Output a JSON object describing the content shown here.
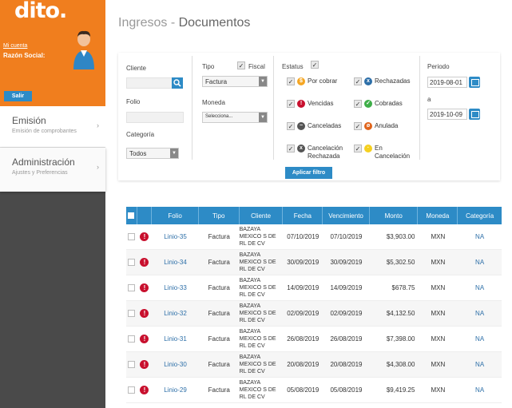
{
  "brand": {
    "logo": "dito.",
    "account_link": "Mi cuenta",
    "social_label": "Razón Social:",
    "logout": "Salir"
  },
  "menu": [
    {
      "title": "Emisión",
      "subtitle": "Emisión de comprobantes"
    },
    {
      "title": "Administración",
      "subtitle": "Ajustes y Preferencias"
    }
  ],
  "page_title": {
    "section": "Ingresos",
    "sep": " - ",
    "page": "Documentos"
  },
  "filters": {
    "cliente_label": "Cliente",
    "folio_label": "Folio",
    "categoria_label": "Categoría",
    "categoria_value": "Todos",
    "tipo_label": "Tipo",
    "fiscal_label": "Fiscal",
    "tipo_value": "Factura",
    "moneda_label": "Moneda",
    "moneda_value": "Selecciona...",
    "estatus_label": "Estatus",
    "statuses": [
      {
        "label": "Por cobrar",
        "color": "#f5a623",
        "glyph": "$"
      },
      {
        "label": "Rechazadas",
        "color": "#2d6fa8",
        "glyph": "x"
      },
      {
        "label": "Vencidas",
        "color": "#c8102e",
        "glyph": "!"
      },
      {
        "label": "Cobradas",
        "color": "#3fae49",
        "glyph": "✓"
      },
      {
        "label": "Canceladas",
        "color": "#555555",
        "glyph": "−"
      },
      {
        "label": "Anulada",
        "color": "#e0641b",
        "glyph": "ø"
      },
      {
        "label": "Cancelación Rechazada",
        "color": "#555555",
        "glyph": "x"
      },
      {
        "label": "En Cancelación",
        "color": "#f5d020",
        "glyph": "·"
      }
    ],
    "periodo_label": "Periodo",
    "date_from": "2019-08-01",
    "a_label": "a",
    "date_to": "2019-10-09",
    "apply": "Aplicar filtro"
  },
  "table": {
    "headers": [
      "Folio",
      "Tipo",
      "Cliente",
      "Fecha",
      "Vencimiento",
      "Monto",
      "Moneda",
      "Categoría"
    ],
    "rows": [
      {
        "folio": "Linio-35",
        "tipo": "Factura",
        "cliente": "BAZAYA MEXICO S DE RL DE CV",
        "fecha": "07/10/2019",
        "venc": "07/10/2019",
        "monto": "$3,903.00",
        "moneda": "MXN",
        "cat": "NA"
      },
      {
        "folio": "Linio-34",
        "tipo": "Factura",
        "cliente": "BAZAYA MEXICO S DE RL DE CV",
        "fecha": "30/09/2019",
        "venc": "30/09/2019",
        "monto": "$5,302.50",
        "moneda": "MXN",
        "cat": "NA"
      },
      {
        "folio": "Linio-33",
        "tipo": "Factura",
        "cliente": "BAZAYA MEXICO S DE RL DE CV",
        "fecha": "14/09/2019",
        "venc": "14/09/2019",
        "monto": "$678.75",
        "moneda": "MXN",
        "cat": "NA"
      },
      {
        "folio": "Linio-32",
        "tipo": "Factura",
        "cliente": "BAZAYA MEXICO S DE RL DE CV",
        "fecha": "02/09/2019",
        "venc": "02/09/2019",
        "monto": "$4,132.50",
        "moneda": "MXN",
        "cat": "NA"
      },
      {
        "folio": "Linio-31",
        "tipo": "Factura",
        "cliente": "BAZAYA MEXICO S DE RL DE CV",
        "fecha": "26/08/2019",
        "venc": "26/08/2019",
        "monto": "$7,398.00",
        "moneda": "MXN",
        "cat": "NA"
      },
      {
        "folio": "Linio-30",
        "tipo": "Factura",
        "cliente": "BAZAYA MEXICO S DE RL DE CV",
        "fecha": "20/08/2019",
        "venc": "20/08/2019",
        "monto": "$4,308.00",
        "moneda": "MXN",
        "cat": "NA"
      },
      {
        "folio": "Linio-29",
        "tipo": "Factura",
        "cliente": "BAZAYA MEXICO S DE RL DE CV",
        "fecha": "05/08/2019",
        "venc": "05/08/2019",
        "monto": "$9,419.25",
        "moneda": "MXN",
        "cat": "NA"
      }
    ]
  }
}
